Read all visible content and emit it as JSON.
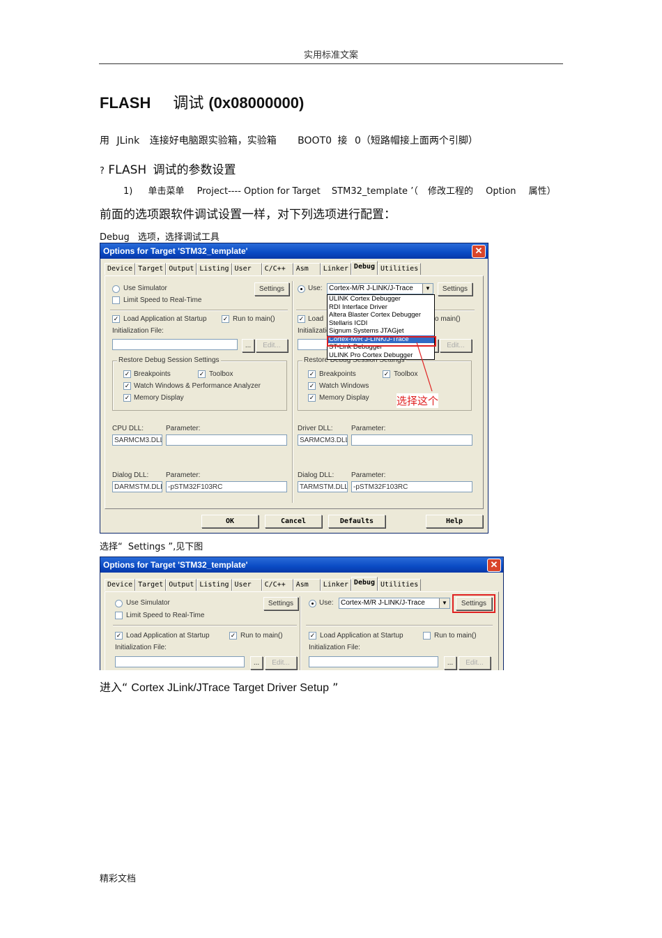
{
  "header": {
    "text": "实用标准文案"
  },
  "footer": {
    "text": "精彩文档"
  },
  "title": {
    "part1": "FLASH",
    "part2": "调试",
    "part3": "(0x08000000)"
  },
  "para1": {
    "a": "用",
    "b": "JLink",
    "c": "连接好电脑跟实验箱，实验箱",
    "d": "BOOT0",
    "e": "接",
    "f": "0（短路帽接上面两个引脚）"
  },
  "para2": {
    "q": "?",
    "a": "FLASH",
    "b": "调试的参数设置"
  },
  "step1": {
    "num": "1)",
    "a": "单击菜单",
    "b": "Project---- Option for Target",
    "c": "STM32_template",
    "d": "’（",
    "e": "修改工程的",
    "f": "Option",
    "g": "属性）"
  },
  "para3": {
    "text": "前面的选项跟软件调试设置一样，对下列选项进行配置："
  },
  "caption1": {
    "a": "Debug",
    "b": "选项，选择调试工具"
  },
  "caption2": {
    "a": "选择“",
    "b": "Settings",
    "c": "”,见下图"
  },
  "caption3": {
    "a": "进入“",
    "b": "Cortex JLink/JTrace Target Driver Setup",
    "c": "”"
  },
  "dialog1": {
    "title": "Options for Target 'STM32_template'",
    "close": "✕",
    "tabs": [
      "Device",
      "Target",
      "Output",
      "Listing",
      "User",
      "C/C++",
      "Asm",
      "Linker",
      "Debug",
      "Utilities"
    ],
    "left": {
      "use_simulator": "Use Simulator",
      "settings": "Settings",
      "limit_speed": "Limit Speed to Real-Time",
      "load_app": "Load Application at Startup",
      "run_main": "Run to main()",
      "init_file": "Initialization File:",
      "browse": "...",
      "edit": "Edit...",
      "restore": "Restore Debug Session Settings",
      "breakpoints": "Breakpoints",
      "toolbox": "Toolbox",
      "watch": "Watch Windows & Performance Analyzer",
      "memory": "Memory Display",
      "cpu_dll": "CPU DLL:",
      "parameter": "Parameter:",
      "cpu_dll_val": "SARMCM3.DLL",
      "dialog_dll": "Dialog DLL:",
      "dialog_dll_val": "DARMSTM.DLL",
      "dialog_param_val": "-pSTM32F103RC"
    },
    "right": {
      "use": "Use:",
      "combo": "Cortex-M/R J-LINK/J-Trace",
      "settings": "Settings",
      "load_app": "Load",
      "run_main": "o main()",
      "init_file": "Initializatio",
      "browse": "...",
      "edit": "Edit...",
      "restore": "Restore Debug Session Settings",
      "breakpoints": "Breakpoints",
      "toolbox": "Toolbox",
      "watch": "Watch Windows",
      "memory": "Memory Display",
      "driver_dll": "Driver DLL:",
      "parameter": "Parameter:",
      "driver_dll_val": "SARMCM3.DLL",
      "dialog_dll": "Dialog DLL:",
      "dialog_dll_val": "TARMSTM.DLL",
      "dialog_param_val": "-pSTM32F103RC",
      "dropdown": [
        "ULINK Cortex Debugger",
        "RDI Interface Driver",
        "Altera Blaster Cortex Debugger",
        "Stellaris ICDI",
        "Signum Systems JTAGjet",
        "Cortex-M/R J-LINK/J-Trace",
        "ST-Link Debugger",
        "ULINK Pro Cortex Debugger"
      ],
      "dropdown_selected_index": 5,
      "annotation": "选择这个"
    },
    "buttons": {
      "ok": "OK",
      "cancel": "Cancel",
      "defaults": "Defaults",
      "help": "Help"
    }
  },
  "dialog2": {
    "title": "Options for Target 'STM32_template'",
    "close": "✕",
    "tabs": [
      "Device",
      "Target",
      "Output",
      "Listing",
      "User",
      "C/C++",
      "Asm",
      "Linker",
      "Debug",
      "Utilities"
    ],
    "left": {
      "use_simulator": "Use Simulator",
      "settings": "Settings",
      "limit_speed": "Limit Speed to Real-Time",
      "load_app": "Load Application at Startup",
      "run_main": "Run to main()",
      "init_file": "Initialization File:",
      "browse": "...",
      "edit": "Edit..."
    },
    "right": {
      "use": "Use:",
      "combo": "Cortex-M/R J-LINK/J-Trace",
      "settings": "Settings",
      "load_app": "Load Application at Startup",
      "run_main": "Run to main()",
      "init_file": "Initialization File:",
      "browse": "...",
      "edit": "Edit..."
    }
  },
  "colors": {
    "title_bar": "#0a4bc4",
    "dialog_bg": "#ece9d8",
    "highlight": "#e02020",
    "selection": "#316ac5"
  }
}
